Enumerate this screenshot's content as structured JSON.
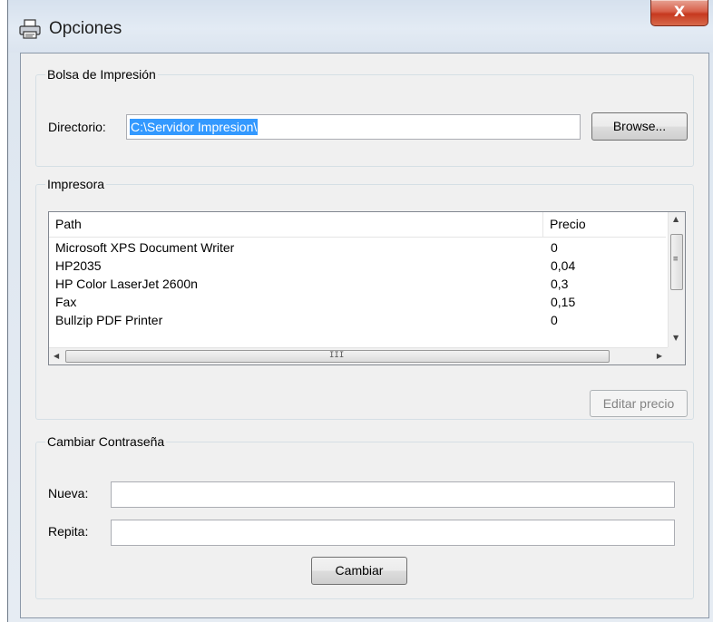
{
  "window": {
    "title": "Opciones",
    "close_label": "X",
    "icon": "printer-icon"
  },
  "bolsa": {
    "legend": "Bolsa de Impresión",
    "directorio_label": "Directorio:",
    "directorio_value": "C:\\Servidor Impresion\\",
    "browse_label": "Browse..."
  },
  "impresora": {
    "legend": "Impresora",
    "columns": [
      "Path",
      "Precio"
    ],
    "rows": [
      {
        "path": "Microsoft XPS Document Writer",
        "precio": "0"
      },
      {
        "path": "HP2035",
        "precio": "0,04"
      },
      {
        "path": "HP Color LaserJet 2600n",
        "precio": "0,3"
      },
      {
        "path": "Fax",
        "precio": "0,15"
      },
      {
        "path": "Bullzip PDF Printer",
        "precio": "0"
      }
    ],
    "scroll_grip": "III",
    "editar_label": "Editar precio"
  },
  "password": {
    "legend": "Cambiar Contraseña",
    "nueva_label": "Nueva:",
    "nueva_value": "",
    "repita_label": "Repita:",
    "repita_value": "",
    "cambiar_label": "Cambiar"
  }
}
